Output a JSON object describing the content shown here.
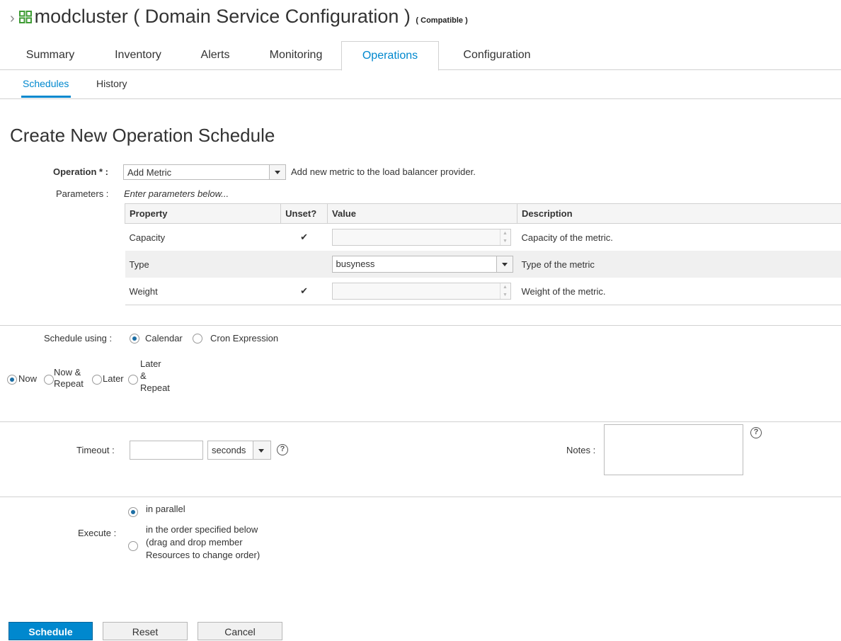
{
  "header": {
    "breadcrumb_glyph": "›",
    "title": "modcluster ( Domain Service Configuration )",
    "badge": "( Compatible )"
  },
  "tabs": [
    {
      "label": "Summary"
    },
    {
      "label": "Inventory"
    },
    {
      "label": "Alerts"
    },
    {
      "label": "Monitoring"
    },
    {
      "label": "Operations",
      "active": true
    },
    {
      "label": "Configuration"
    }
  ],
  "subtabs": [
    {
      "label": "Schedules",
      "active": true
    },
    {
      "label": "History"
    }
  ],
  "page_heading": "Create New Operation Schedule",
  "operation": {
    "label": "Operation * :",
    "selected": "Add Metric",
    "description": "Add new metric to the load balancer provider."
  },
  "parameters": {
    "label": "Parameters :",
    "hint": "Enter parameters below...",
    "columns": [
      "Property",
      "Unset?",
      "Value",
      "Description"
    ],
    "rows": [
      {
        "property": "Capacity",
        "unset": "✔",
        "value": "",
        "description": "Capacity of the metric."
      },
      {
        "property": "Type",
        "unset": "",
        "value": "busyness",
        "description": "Type of the metric"
      },
      {
        "property": "Weight",
        "unset": "✔",
        "value": "",
        "description": "Weight of the metric."
      }
    ]
  },
  "schedule": {
    "label": "Schedule using :",
    "calendar": "Calendar",
    "cron": "Cron Expression",
    "selected": "Calendar"
  },
  "when": {
    "now": "Now",
    "now_repeat_1": "Now &",
    "now_repeat_2": "Repeat",
    "later": "Later",
    "later_repeat_1": "Later",
    "later_repeat_2": "&",
    "later_repeat_3": "Repeat",
    "selected": "Now"
  },
  "timeout": {
    "label": "Timeout :",
    "value": "",
    "unit": "seconds"
  },
  "notes": {
    "label": "Notes :",
    "value": ""
  },
  "execute": {
    "label": "Execute :",
    "parallel": "in parallel",
    "ordered_1": "in the order specified below",
    "ordered_2": "(drag and drop member",
    "ordered_3": "Resources to change order)",
    "selected": "in parallel"
  },
  "buttons": {
    "schedule": "Schedule",
    "reset": "Reset",
    "cancel": "Cancel"
  },
  "colors": {
    "accent": "#0088ce",
    "gridicon": "#3f9c35"
  }
}
